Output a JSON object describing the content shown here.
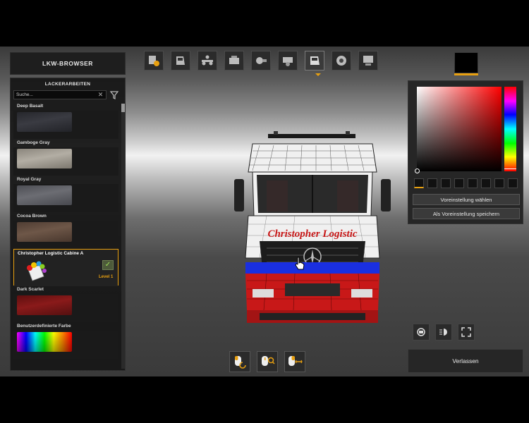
{
  "header": {
    "title": "LKW-BROWSER"
  },
  "panel": {
    "title": "LACKERARBEITEN",
    "search": {
      "value": "Suche..."
    }
  },
  "paints": [
    {
      "name": "Deep Basalt",
      "colors": [
        "#26272c",
        "#3a3b42",
        "#222328"
      ]
    },
    {
      "name": "Gamboge Gray",
      "colors": [
        "#8a857c",
        "#b3aea4",
        "#7c776e"
      ]
    },
    {
      "name": "Royal Gray",
      "colors": [
        "#4d4e54",
        "#6c6d73",
        "#47484e"
      ]
    },
    {
      "name": "Cocoa Brown",
      "colors": [
        "#4f3d33",
        "#6e5748",
        "#48372d"
      ]
    },
    {
      "name": "Christopher Logistic Cabine A",
      "selected": true,
      "level": "Level 1"
    },
    {
      "name": "Dark Scarlet",
      "colors": [
        "#5e0f0f",
        "#8a1a1a",
        "#541010"
      ]
    },
    {
      "name": "Benutzerdefinierte Farbe",
      "rainbow": true
    }
  ],
  "toolbar": {
    "icons": [
      "paint-brush-icon",
      "cabin-icon",
      "chassis-icon",
      "engine-icon",
      "transmission-icon",
      "interior-icon",
      "paintjob-icon",
      "wheels-icon",
      "accessories-icon"
    ],
    "active_index": 6
  },
  "color_picker": {
    "current_color": "#000000",
    "select_preset": "Voreinstellung wählen",
    "save_preset": "Als Voreinstellung speichern"
  },
  "truck": {
    "livery_text": "Christopher Logistic",
    "colors": {
      "white": "#f0f0f0",
      "red": "#c81818",
      "blue": "#1a2fe0"
    }
  },
  "exit_label": "Verlassen",
  "accent": "#e8a010"
}
